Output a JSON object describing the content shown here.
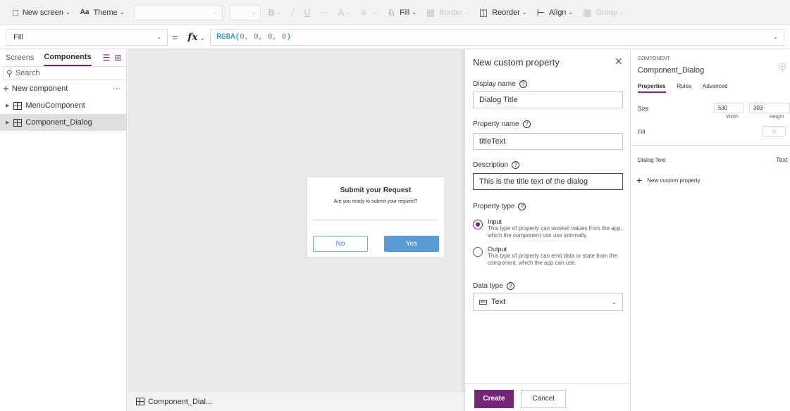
{
  "toolbar": {
    "new_screen": "New screen",
    "theme": "Theme",
    "bold": "B",
    "italic": "/",
    "underline": "U",
    "strike": "—",
    "font_color": "A",
    "fill": "Fill",
    "border": "Border",
    "reorder": "Reorder",
    "align": "Align",
    "group": "Group"
  },
  "formula_bar": {
    "property": "Fill",
    "equals": "=",
    "fx": "fx",
    "formula_fn": "RGBA(",
    "formula_args": "0, 0, 0, 0",
    "formula_close": ")"
  },
  "left_panel": {
    "tabs": [
      "Screens",
      "Components"
    ],
    "active_tab": "Components",
    "search_placeholder": "Search",
    "new_component": "New component",
    "more": "···",
    "items": [
      "MenuComponent",
      "Component_Dialog"
    ],
    "selected_item": "Component_Dialog"
  },
  "canvas": {
    "dialog_title": "Submit your Request",
    "dialog_text": "Are you ready to submit your request?",
    "no_label": "No",
    "yes_label": "Yes",
    "footer_label": "Component_Dial..."
  },
  "custom_property": {
    "title": "New custom property",
    "display_name_label": "Display name",
    "display_name_value": "Dialog Title",
    "property_name_label": "Property name",
    "property_name_value": "titleText",
    "description_label": "Description",
    "description_value": "This is the title text of the dialog",
    "property_type_label": "Property type",
    "input_label": "Input",
    "input_desc": "This type of property can receive values from the app, which the component can use internally.",
    "output_label": "Output",
    "output_desc": "This type of property can emit data or state from the component, which the app can use.",
    "selected_type": "Input",
    "data_type_label": "Data type",
    "data_type_value": "Text",
    "create_label": "Create",
    "cancel_label": "Cancel"
  },
  "properties_panel": {
    "kind": "COMPONENT",
    "name": "Component_Dialog",
    "tabs": [
      "Properties",
      "Rules",
      "Advanced"
    ],
    "active_tab": "Properties",
    "size_label": "Size",
    "width_value": "530",
    "height_value": "303",
    "width_caption": "Width",
    "height_caption": "Height",
    "fill_label": "Fill",
    "custom_prop_name": "Dialog Text",
    "custom_prop_type": "Text",
    "new_custom_property": "New custom property"
  },
  "colors": {
    "accent": "#742774",
    "canvas_bg": "#e8e8e8",
    "yes_button": "#5b9bd5",
    "no_button_border": "#6fa8dc",
    "formula_fn": "#0078d4",
    "formula_num": "#8764b8"
  },
  "icons": {
    "new_screen": "screen-icon",
    "theme": "theme-icon",
    "fill": "paint-bucket-icon",
    "reorder": "reorder-icon",
    "align": "align-icon",
    "component": "component-icon",
    "search": "search-icon",
    "close": "close-icon",
    "help": "help-icon",
    "plus": "plus-icon"
  }
}
